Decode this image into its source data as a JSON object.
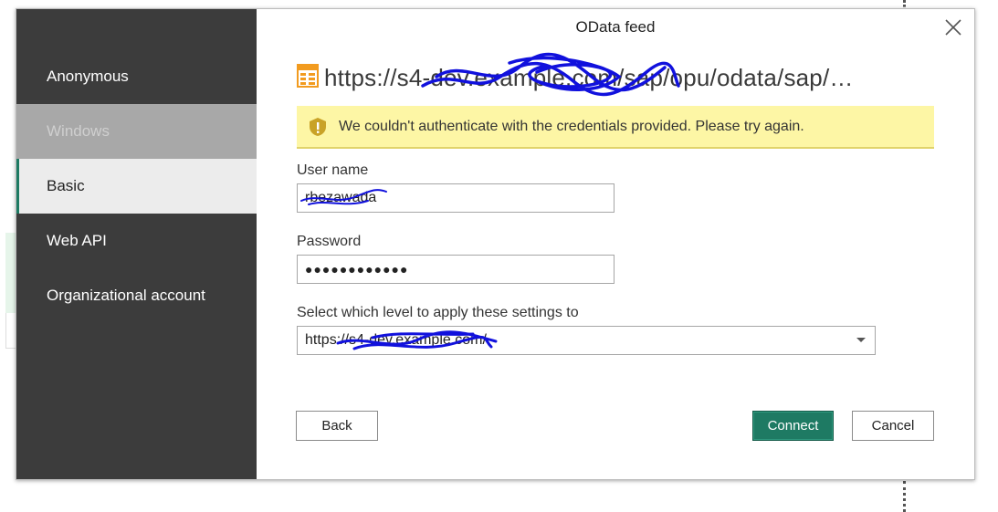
{
  "dialog": {
    "title": "OData feed",
    "url": "https://s4-dev.example.com/sap/opu/odata/sap/…"
  },
  "sidebar": {
    "items": [
      {
        "label": "Anonymous",
        "state": "normal"
      },
      {
        "label": "Windows",
        "state": "disabled"
      },
      {
        "label": "Basic",
        "state": "selected"
      },
      {
        "label": "Web API",
        "state": "normal"
      },
      {
        "label": "Organizational account",
        "state": "normal"
      }
    ]
  },
  "warning": {
    "text": "We couldn't authenticate with the credentials provided. Please try again."
  },
  "form": {
    "username_label": "User name",
    "username_value": "rbezawada",
    "password_label": "Password",
    "password_value": "●●●●●●●●●●●●",
    "level_label": "Select which level to apply these settings to",
    "level_value": "https://s4-dev.example.com/"
  },
  "buttons": {
    "back": "Back",
    "connect": "Connect",
    "cancel": "Cancel"
  },
  "colors": {
    "sidebar_bg": "#3c3c3c",
    "selected_accent": "#1e7a63",
    "warning_bg": "#fdf6a5",
    "feed_icon": "#f29b1f",
    "redaction_ink": "#1111dd"
  },
  "icons": {
    "close": "close-icon",
    "feed": "odata-feed-icon",
    "warning": "warning-shield-icon",
    "dropdown": "chevron-down-icon"
  }
}
